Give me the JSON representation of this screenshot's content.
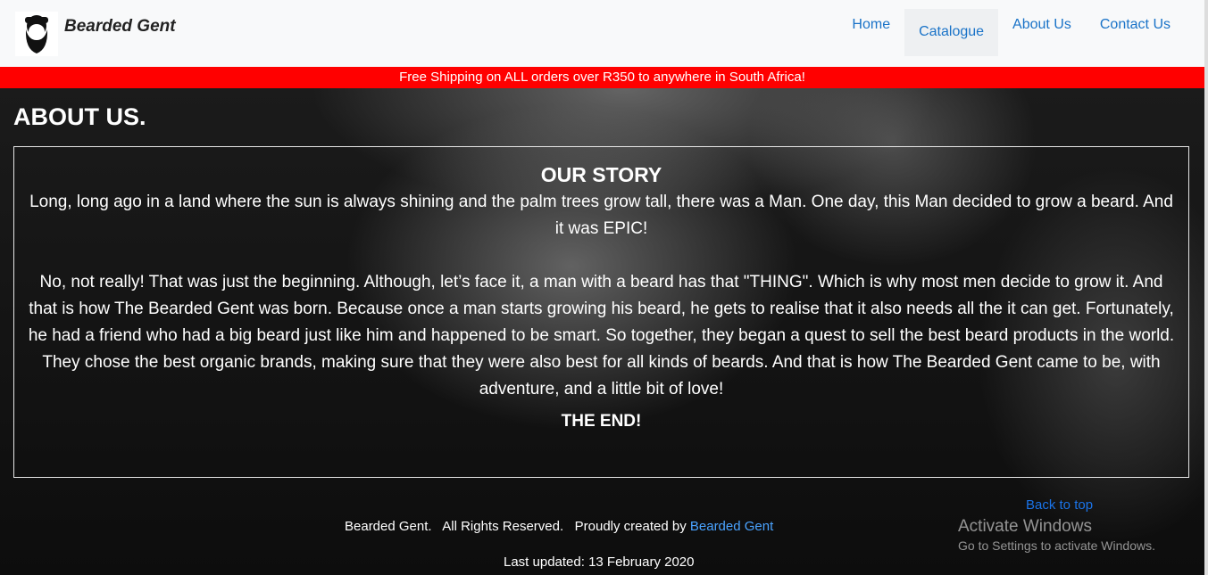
{
  "brand": {
    "name": "Bearded Gent",
    "logo_icon": "bearded-man-icon"
  },
  "nav": [
    {
      "label": "Home"
    },
    {
      "label": "Catalogue"
    },
    {
      "label": "About Us"
    },
    {
      "label": "Contact Us"
    }
  ],
  "banner": {
    "text": "Free Shipping on ALL orders over R350 to anywhere in South Africa!"
  },
  "page": {
    "title": "ABOUT US."
  },
  "story": {
    "heading": "OUR STORY",
    "p1": "Long, long ago in a land where the sun is always shining and the palm trees grow tall, there was a Man. One day, this Man decided to grow a beard. And it was EPIC!",
    "p2": "No, not really! That was just the beginning. Although, let’s face it, a man with a beard has that \"THING\". Which is why most men decide to grow it. And that is how The Bearded Gent was born. Because once a man starts growing his beard, he gets to realise that it also needs all the it can get. Fortunately, he had a friend who had a big beard just like him and happened to be smart. So together, they began a quest to sell the best beard products in the world. They chose the best organic brands, making sure that they were also best for all kinds of beards. And that is how The Bearded Gent came to be, with adventure, and a little bit of love!",
    "end": "THE END!"
  },
  "footer": {
    "back_to_top": "Back to top",
    "rights": "Bearded Gent.   All Rights Reserved.   Proudly created by ",
    "creator_link": "Bearded Gent",
    "updated": "Last updated: 13 February 2020"
  },
  "os_overlay": {
    "title": "Activate Windows",
    "subtitle": "Go to Settings to activate Windows."
  },
  "colors": {
    "banner": "#ff0000",
    "link": "#1a73c8",
    "navbar_bg": "#f8f9fa"
  }
}
